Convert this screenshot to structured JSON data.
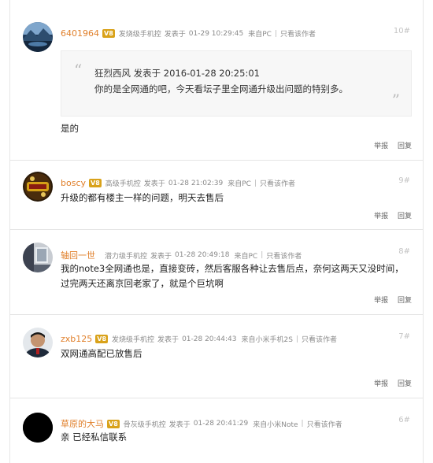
{
  "posts": [
    {
      "username": "6401964",
      "badge": "V8",
      "group": "发烧级手机控",
      "posted_label": "发表于",
      "time": "01-29 10:29:45",
      "source": "来自PC",
      "only_op": "只看该作者",
      "floor": "10#",
      "avatar_icon": "avatar-mountain-lake",
      "quote": {
        "header": "狂烈西风 发表于 2016-01-28 20:25:01",
        "body": "你的是全网通的吧，今天看坛子里全网通升级出问题的特别多。"
      },
      "content": "是的",
      "report": "举报",
      "reply": "回复"
    },
    {
      "username": "boscy",
      "badge": "V8",
      "group": "高级手机控",
      "posted_label": "发表于",
      "time": "01-28 21:02:39",
      "source": "来自PC",
      "only_op": "只看该作者",
      "floor": "9#",
      "avatar_icon": "avatar-game-logo",
      "content": "升级的都有楼主一样的问题，明天去售后",
      "report": "举报",
      "reply": "回复"
    },
    {
      "username": "轴回一世",
      "badge": "",
      "group": "潜力级手机控",
      "posted_label": "发表于",
      "time": "01-28 20:49:18",
      "source": "来自PC",
      "only_op": "只看该作者",
      "floor": "8#",
      "avatar_icon": "avatar-room",
      "content": "我的note3全网通也是，直接变砖，然后客服各种让去售后点，奈何这两天又没时间，过完两天还离京回老家了，就是个巨坑啊",
      "report": "举报",
      "reply": "回复"
    },
    {
      "username": "zxb125",
      "badge": "V8",
      "group": "发烧级手机控",
      "posted_label": "发表于",
      "time": "01-28 20:44:43",
      "source": "来自小米手机2S",
      "only_op": "只看该作者",
      "floor": "7#",
      "avatar_icon": "avatar-man-portrait",
      "content": "双网通高配已放售后",
      "report": "举报",
      "reply": "回复"
    },
    {
      "username": "草原的大马",
      "badge": "V8",
      "group": "骨灰级手机控",
      "posted_label": "发表于",
      "time": "01-28 20:41:29",
      "source": "来自小米Note",
      "only_op": "只看该作者",
      "floor": "6#",
      "avatar_icon": "avatar-black",
      "content": "亲 已经私信联系",
      "report": "",
      "reply": ""
    }
  ],
  "colors": {
    "username": "#e07f2a",
    "badge": "#d9a21a",
    "meta": "#8a8a8a",
    "floor": "#c4c4c4",
    "quote_bg": "#f7f7f7"
  }
}
